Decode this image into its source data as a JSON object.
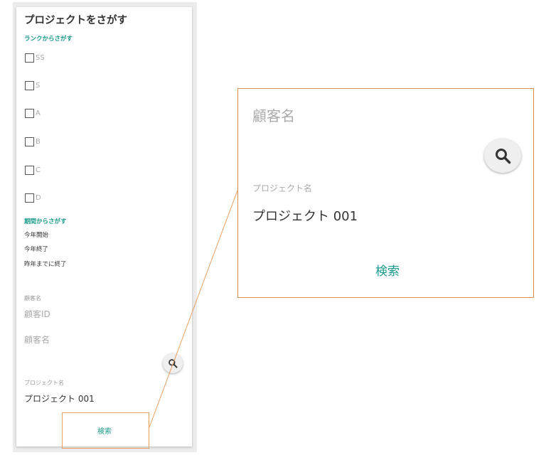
{
  "panel": {
    "title": "プロジェクトをさがす",
    "rank_section_label": "ランクからさがす",
    "ranks": [
      "SS",
      "S",
      "A",
      "B",
      "C",
      "D"
    ],
    "period_section_label": "期間からさがす",
    "periods": [
      "今年開始",
      "今年終了",
      "昨年までに終了"
    ],
    "customer_label": "顧客名",
    "customer_id_placeholder": "顧客ID",
    "customer_name_placeholder": "顧客名",
    "project_label": "プロジェクト名",
    "project_value": "プロジェクト 001",
    "search_button": "検索",
    "search_icon": "search-icon"
  },
  "zoom": {
    "customer_name_placeholder": "顧客名",
    "project_label": "プロジェクト名",
    "project_value": "プロジェクト 001",
    "search_button": "検索",
    "search_icon": "search-icon"
  },
  "colors": {
    "accent": "#1a9a8a",
    "highlight": "#e8a060"
  }
}
